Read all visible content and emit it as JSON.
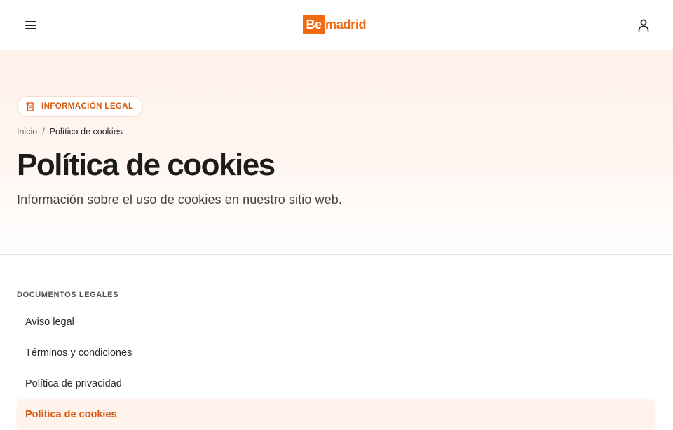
{
  "header": {
    "menu_icon": "hamburger-menu-icon",
    "logo": {
      "prefix": "Be",
      "suffix": "madrid"
    },
    "user_icon": "user-account-icon"
  },
  "hero": {
    "badge": {
      "icon": "legal-document-icon",
      "label": "INFORMACIÓN LEGAL"
    },
    "breadcrumb": {
      "home": "Inicio",
      "separator": "/",
      "current": "Política de cookies"
    },
    "title": "Política de cookies",
    "subtitle": "Información sobre el uso de cookies en nuestro sitio web."
  },
  "legal_nav": {
    "heading": "DOCUMENTOS LEGALES",
    "items": [
      {
        "label": "Aviso legal",
        "active": false
      },
      {
        "label": "Términos y condiciones",
        "active": false
      },
      {
        "label": "Política de privacidad",
        "active": false
      },
      {
        "label": "Política de cookies",
        "active": true
      }
    ]
  },
  "colors": {
    "brand": "#f26a0f",
    "accent_text": "#d55a12",
    "hero_tint": "#fff1ea"
  }
}
